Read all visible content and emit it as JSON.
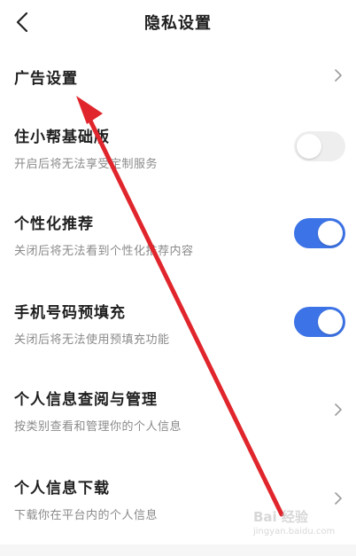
{
  "header": {
    "title": "隐私设置",
    "back_icon": "chevron-left-icon"
  },
  "settings": [
    {
      "title": "广告设置",
      "subtitle": "",
      "control": "chevron"
    },
    {
      "title": "住小帮基础版",
      "subtitle": "开启后将无法享受定制服务",
      "control": "toggle",
      "on": false
    },
    {
      "title": "个性化推荐",
      "subtitle": "关闭后将无法看到个性化推荐内容",
      "control": "toggle",
      "on": true
    },
    {
      "title": "手机号码预填充",
      "subtitle": "关闭后将无法使用预填充功能",
      "control": "toggle",
      "on": true
    },
    {
      "title": "个人信息查阅与管理",
      "subtitle": "按类别查看和管理你的个人信息",
      "control": "chevron"
    },
    {
      "title": "个人信息下载",
      "subtitle": "下载你在平台内的个人信息",
      "control": "chevron"
    }
  ],
  "watermark": {
    "text": "Bai 经验",
    "url": "jingyan.baidu.com"
  },
  "colors": {
    "toggle_on": "#3c73e6",
    "toggle_off": "#eeeeee",
    "annotation_arrow": "#e0262c"
  }
}
